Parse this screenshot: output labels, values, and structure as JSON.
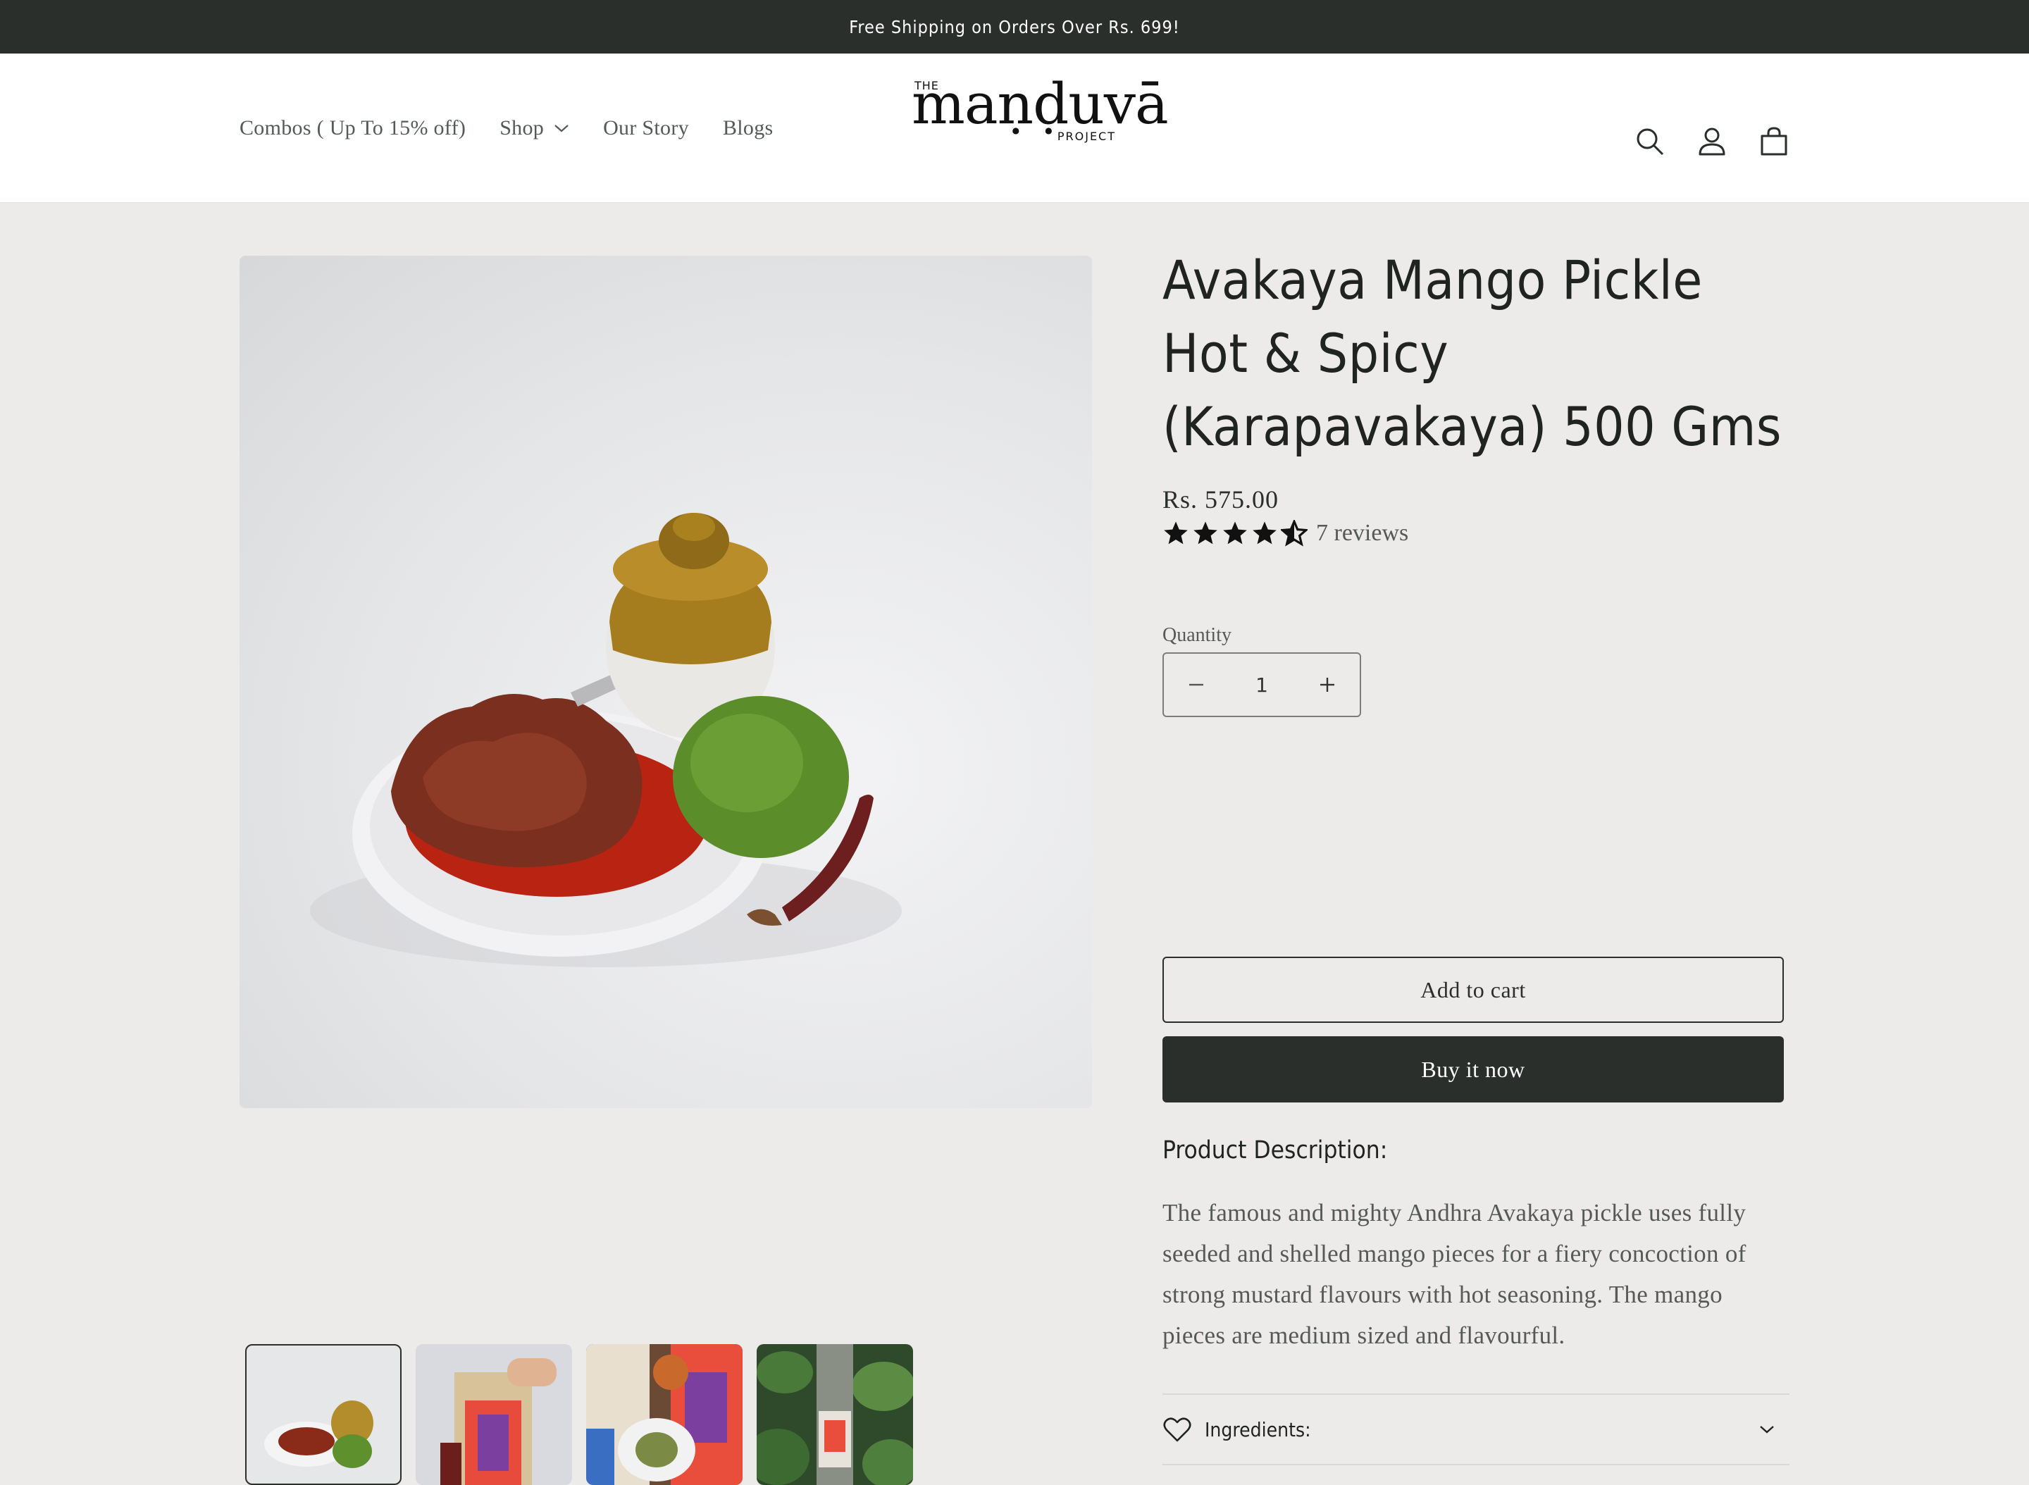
{
  "announcement": {
    "text": "Free Shipping on Orders Over Rs. 699!"
  },
  "nav": {
    "items": [
      {
        "label": "Combos ( Up To 15% off)",
        "has_dropdown": false
      },
      {
        "label": "Shop",
        "has_dropdown": true
      },
      {
        "label": "Our Story",
        "has_dropdown": false
      },
      {
        "label": "Blogs",
        "has_dropdown": false
      }
    ]
  },
  "logo": {
    "the": "THE",
    "word": "maṇḍuvā",
    "project": "PROJECT"
  },
  "header_icons": [
    "search-icon",
    "account-icon",
    "cart-icon"
  ],
  "product": {
    "title": "Avakaya Mango Pickle Hot & Spicy (Karapavakaya) 500 Gms",
    "price": "Rs. 575.00",
    "rating": 4.5,
    "reviews_text": "7 reviews",
    "quantity_label": "Quantity",
    "quantity_value": "1",
    "add_to_cart": "Add to cart",
    "buy_now": "Buy it now",
    "description_heading": "Product Description:",
    "description": "The famous and mighty Andhra Avakaya pickle uses fully seeded and shelled mango pieces for a fiery concoction of strong mustard flavours with hot seasoning. The mango pieces are medium sized and flavourful.",
    "accordion_label": "Ingredients:"
  },
  "gallery": {
    "thumbnail_count": 4,
    "active_index": 0
  },
  "colors": {
    "dark": "#2a2f2c",
    "background": "#ecebea",
    "text_muted": "#555957"
  }
}
